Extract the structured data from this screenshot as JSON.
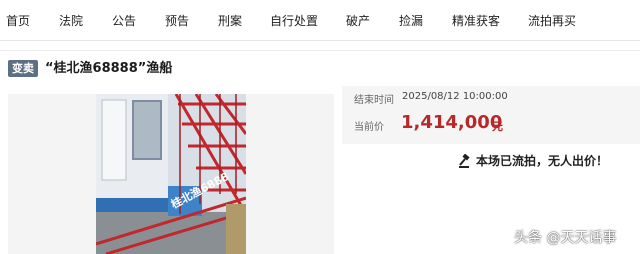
{
  "nav": {
    "items": [
      "首页",
      "法院",
      "公告",
      "预告",
      "刑案",
      "自行处置",
      "破产",
      "捡漏",
      "精准获客",
      "流拍再买"
    ]
  },
  "lot": {
    "badge": "变卖",
    "title": "“桂北渔68888”渔船"
  },
  "photo": {
    "sign_text": "桂北渔6888"
  },
  "info": {
    "end_time_label": "结束时间",
    "end_time_value": "2025/08/12 10:00:00",
    "price_label": "当前价",
    "price_value": "1,414,000",
    "price_unit": "元"
  },
  "status": {
    "message": "本场已流拍，无人出价！",
    "icon": "gavel-icon"
  },
  "watermark": {
    "text": "头条 @天天话事"
  },
  "colors": {
    "price": "#b8282a",
    "badge": "#5c6f83",
    "panel": "#f5f5f5"
  }
}
